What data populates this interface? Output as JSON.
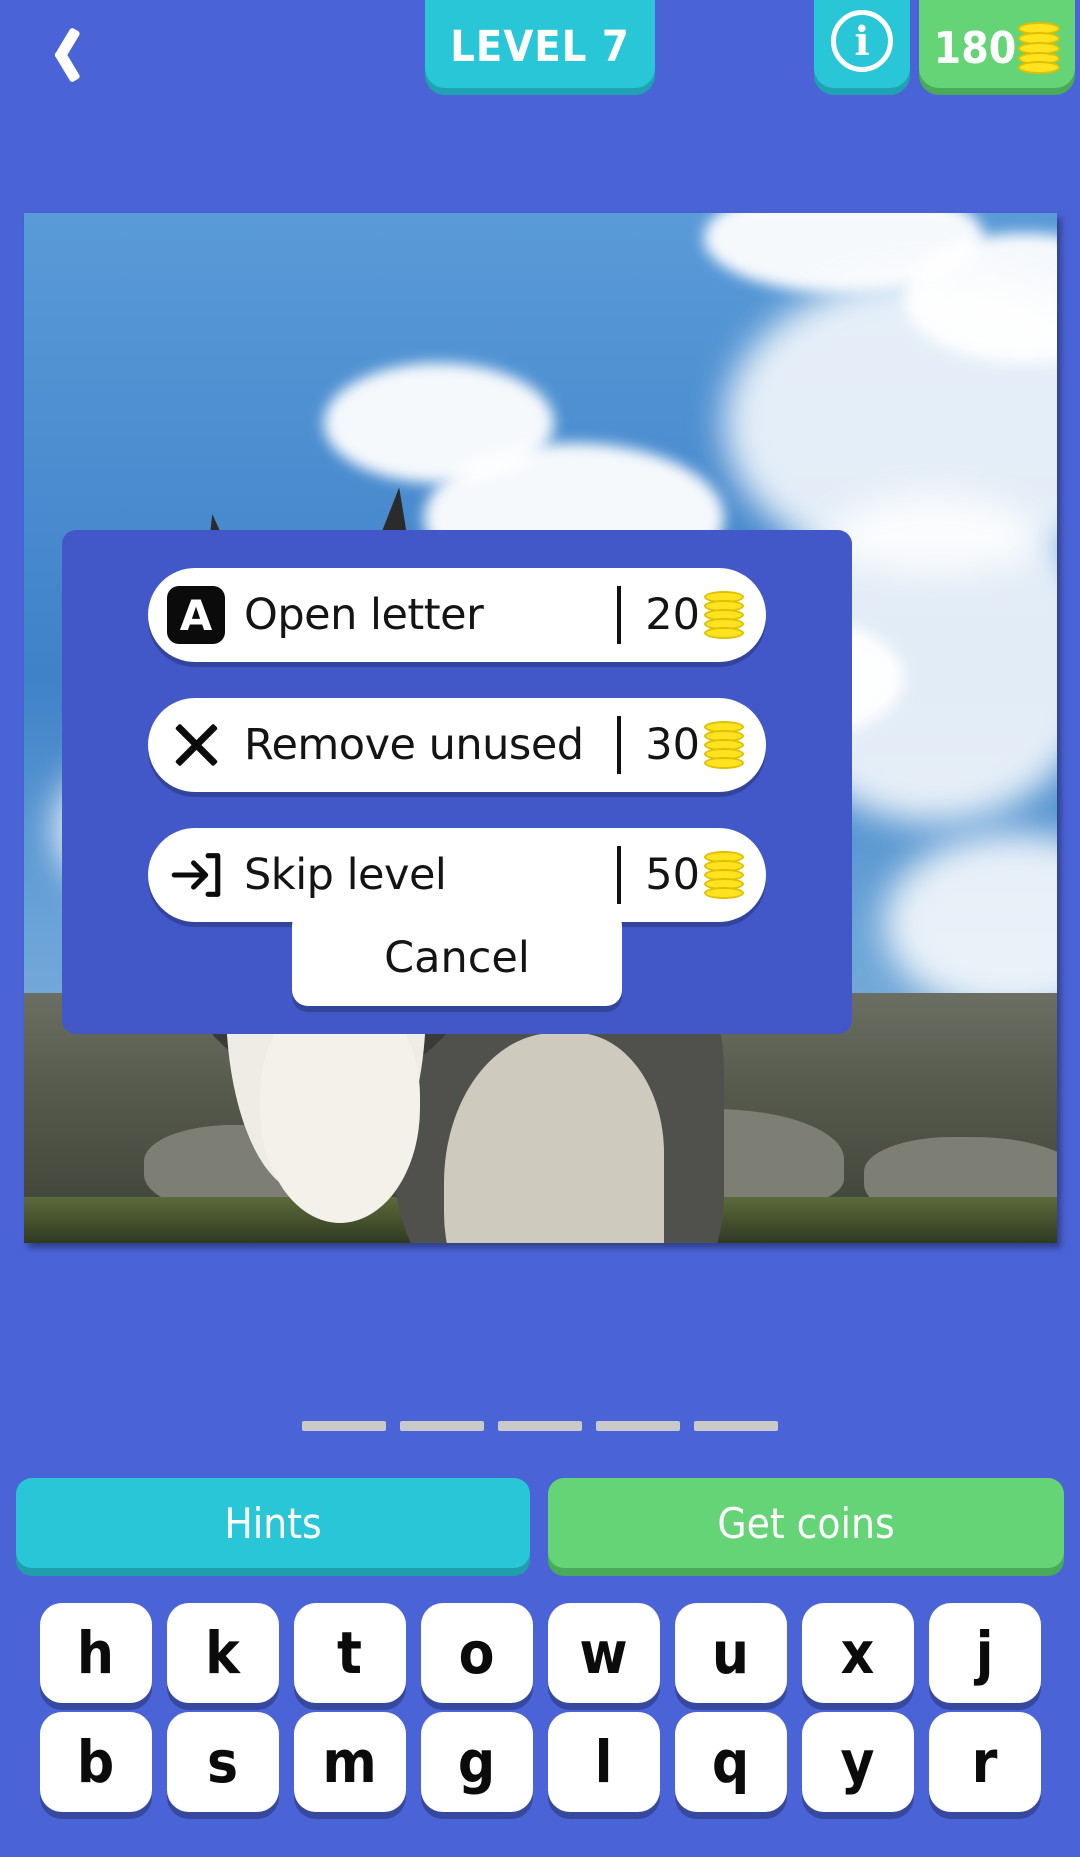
{
  "theme": {
    "background": "#4a63d6",
    "accent_teal": "#29c6d8",
    "accent_green": "#64d477",
    "modal_blue": "#4258c9",
    "coin_yellow": "#ffe31f"
  },
  "header": {
    "back_icon": "chevron-left-icon",
    "level_label": "LEVEL 7",
    "info_icon": "info-icon",
    "info_glyph": "i",
    "coin_balance": "180",
    "coin_icon": "coin-stack-icon"
  },
  "photo": {
    "alt": "Husky dog looking up against a blue sky with white clouds over a rocky mountain ridge"
  },
  "modal": {
    "options": [
      {
        "icon": "letter-a-icon",
        "glyph": "A",
        "label": "Open letter",
        "price": "20",
        "coin_icon": "coin-stack-icon"
      },
      {
        "icon": "close-x-icon",
        "glyph": "",
        "label": "Remove unused",
        "price": "30",
        "coin_icon": "coin-stack-icon"
      },
      {
        "icon": "skip-arrow-icon",
        "glyph": "",
        "label": "Skip level",
        "price": "50",
        "coin_icon": "coin-stack-icon"
      }
    ],
    "cancel_label": "Cancel"
  },
  "answer_slots": {
    "count": 5,
    "letters": [
      "",
      "",
      "",
      "",
      ""
    ]
  },
  "actions": {
    "hints_label": "Hints",
    "get_coins_label": "Get coins"
  },
  "keyboard": {
    "row1": [
      "h",
      "k",
      "t",
      "o",
      "w",
      "u",
      "x",
      "j"
    ],
    "row2": [
      "b",
      "s",
      "m",
      "g",
      "l",
      "q",
      "y",
      "r"
    ]
  }
}
